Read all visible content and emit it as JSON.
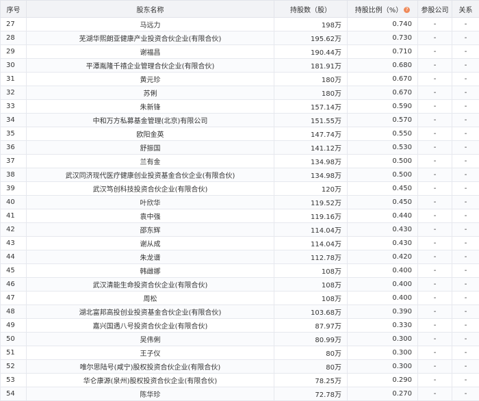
{
  "header": {
    "index": "序号",
    "name": "股东名称",
    "shares": "持股数（股）",
    "ratio": "持股比例（%）",
    "company": "参股公司",
    "relation": "关系"
  },
  "rows": [
    {
      "index": "27",
      "name": "马远力",
      "shares": "198万",
      "ratio": "0.740",
      "company": "-",
      "relation": "-"
    },
    {
      "index": "28",
      "name": "芜湖华熙朗亚健康产业投资合伙企业(有限合伙)",
      "shares": "195.62万",
      "ratio": "0.730",
      "company": "-",
      "relation": "-"
    },
    {
      "index": "29",
      "name": "谢福昌",
      "shares": "190.44万",
      "ratio": "0.710",
      "company": "-",
      "relation": "-"
    },
    {
      "index": "30",
      "name": "平潭胤隆千禧企业管理合伙企业(有限合伙)",
      "shares": "181.91万",
      "ratio": "0.680",
      "company": "-",
      "relation": "-"
    },
    {
      "index": "31",
      "name": "黄元珍",
      "shares": "180万",
      "ratio": "0.670",
      "company": "-",
      "relation": "-"
    },
    {
      "index": "32",
      "name": "苏俐",
      "shares": "180万",
      "ratio": "0.670",
      "company": "-",
      "relation": "-"
    },
    {
      "index": "33",
      "name": "朱新锋",
      "shares": "157.14万",
      "ratio": "0.590",
      "company": "-",
      "relation": "-"
    },
    {
      "index": "34",
      "name": "中和万方私募基金管理(北京)有限公司",
      "shares": "151.55万",
      "ratio": "0.570",
      "company": "-",
      "relation": "-"
    },
    {
      "index": "35",
      "name": "欧阳金英",
      "shares": "147.74万",
      "ratio": "0.550",
      "company": "-",
      "relation": "-"
    },
    {
      "index": "36",
      "name": "舒振国",
      "shares": "141.12万",
      "ratio": "0.530",
      "company": "-",
      "relation": "-"
    },
    {
      "index": "37",
      "name": "兰有金",
      "shares": "134.98万",
      "ratio": "0.500",
      "company": "-",
      "relation": "-"
    },
    {
      "index": "38",
      "name": "武汉同济现代医疗健康创业投资基金合伙企业(有限合伙)",
      "shares": "134.98万",
      "ratio": "0.500",
      "company": "-",
      "relation": "-"
    },
    {
      "index": "39",
      "name": "武汉笃创科技投资合伙企业(有限合伙)",
      "shares": "120万",
      "ratio": "0.450",
      "company": "-",
      "relation": "-"
    },
    {
      "index": "40",
      "name": "叶欣华",
      "shares": "119.52万",
      "ratio": "0.450",
      "company": "-",
      "relation": "-"
    },
    {
      "index": "41",
      "name": "袁中强",
      "shares": "119.16万",
      "ratio": "0.440",
      "company": "-",
      "relation": "-"
    },
    {
      "index": "42",
      "name": "邵东辉",
      "shares": "114.04万",
      "ratio": "0.430",
      "company": "-",
      "relation": "-"
    },
    {
      "index": "43",
      "name": "谢从成",
      "shares": "114.04万",
      "ratio": "0.430",
      "company": "-",
      "relation": "-"
    },
    {
      "index": "44",
      "name": "朱龙谱",
      "shares": "112.78万",
      "ratio": "0.420",
      "company": "-",
      "relation": "-"
    },
    {
      "index": "45",
      "name": "韩雌娜",
      "shares": "108万",
      "ratio": "0.400",
      "company": "-",
      "relation": "-"
    },
    {
      "index": "46",
      "name": "武汉清能生命投资合伙企业(有限合伙)",
      "shares": "108万",
      "ratio": "0.400",
      "company": "-",
      "relation": "-"
    },
    {
      "index": "47",
      "name": "周松",
      "shares": "108万",
      "ratio": "0.400",
      "company": "-",
      "relation": "-"
    },
    {
      "index": "48",
      "name": "湖北富邦高投创业投资基金合伙企业(有限合伙)",
      "shares": "103.68万",
      "ratio": "0.390",
      "company": "-",
      "relation": "-"
    },
    {
      "index": "49",
      "name": "嘉兴国遇八号投资合伙企业(有限合伙)",
      "shares": "87.97万",
      "ratio": "0.330",
      "company": "-",
      "relation": "-"
    },
    {
      "index": "50",
      "name": "吴伟俐",
      "shares": "80.99万",
      "ratio": "0.300",
      "company": "-",
      "relation": "-"
    },
    {
      "index": "51",
      "name": "王子仪",
      "shares": "80万",
      "ratio": "0.300",
      "company": "-",
      "relation": "-"
    },
    {
      "index": "52",
      "name": "唯尔思陆号(咸宁)股权投资合伙企业(有限合伙)",
      "shares": "80万",
      "ratio": "0.300",
      "company": "-",
      "relation": "-"
    },
    {
      "index": "53",
      "name": "华仑康源(泉州)股权投资合伙企业(有限合伙)",
      "shares": "78.25万",
      "ratio": "0.290",
      "company": "-",
      "relation": "-"
    },
    {
      "index": "54",
      "name": "陈华珍",
      "shares": "72.78万",
      "ratio": "0.270",
      "company": "-",
      "relation": "-"
    }
  ],
  "icons": {
    "ratio_info": "info-icon"
  },
  "colors": {
    "header_bg": "#f2f3f6",
    "info_icon": "#ef8a5a"
  }
}
